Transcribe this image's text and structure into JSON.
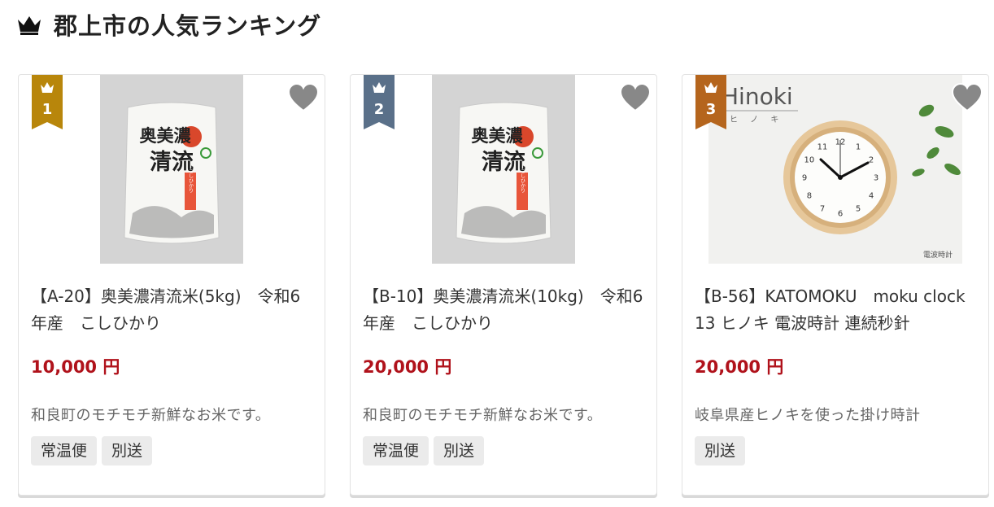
{
  "section": {
    "title": "郡上市の人気ランキング",
    "icon": "crown-icon"
  },
  "colors": {
    "price": "#b0121b",
    "rank_gold": "#b8860b",
    "rank_silver": "#5a7089",
    "rank_bronze": "#b5651d",
    "heart": "#888888"
  },
  "products": [
    {
      "rank": "1",
      "title": "【A-20】奥美濃清流米(5kg)　令和6年産　こしひかり",
      "price": "10,000 円",
      "description": "和良町のモチモチ新鮮なお米です。",
      "tags": [
        "常温便",
        "別送"
      ],
      "image_text": [
        "奥美濃",
        "清流",
        "こしひかり"
      ]
    },
    {
      "rank": "2",
      "title": "【B-10】奥美濃清流米(10kg)　令和6年産　こしひかり",
      "price": "20,000 円",
      "description": "和良町のモチモチ新鮮なお米です。",
      "tags": [
        "常温便",
        "別送"
      ],
      "image_text": [
        "奥美濃",
        "清流",
        "こしひかり"
      ]
    },
    {
      "rank": "3",
      "title": "【B-56】KATOMOKU　moku clock 13 ヒノキ 電波時計 連続秒針",
      "price": "20,000 円",
      "description": "岐阜県産ヒノキを使った掛け時計",
      "tags": [
        "別送"
      ],
      "image_text": [
        "Hinoki",
        "ヒ ノ キ",
        "電波時計"
      ],
      "clock_numbers": [
        "12",
        "1",
        "2",
        "3",
        "4",
        "5",
        "6",
        "7",
        "8",
        "9",
        "10",
        "11"
      ]
    }
  ]
}
